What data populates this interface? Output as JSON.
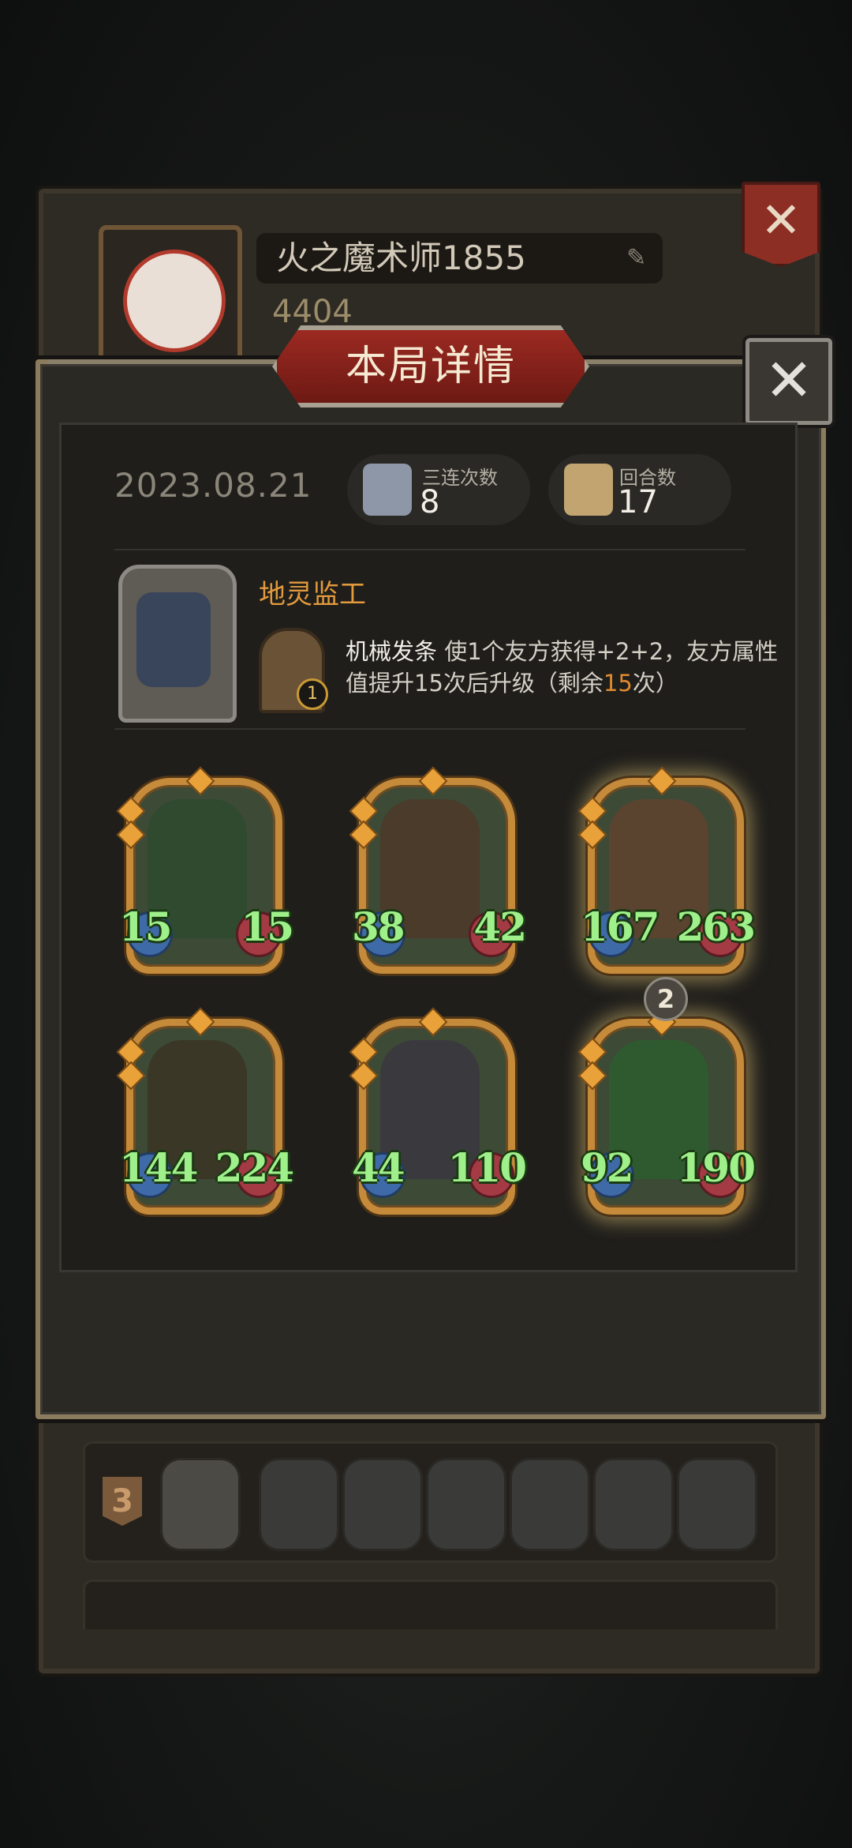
{
  "profile": {
    "name": "火之魔术师1855",
    "score": "4404"
  },
  "back_rows": [
    {
      "rank": "3"
    }
  ],
  "modal": {
    "title": "本局详情",
    "date": "2023.08.21",
    "stats": {
      "triple_label": "三连次数",
      "triple_value": "8",
      "rounds_label": "回合数",
      "rounds_value": "17"
    },
    "hero": {
      "name": "地灵监工",
      "skill_level": "1",
      "skill_name": "机械发条",
      "desc_a": " 使1个友方获得+2+2，友方属性值提升15次后升级（剩余",
      "desc_hl": "15",
      "desc_b": "次）"
    },
    "units": [
      {
        "atk": "15",
        "hp": "15",
        "art_color": "#2f4a2e",
        "golden": false,
        "level": ""
      },
      {
        "atk": "38",
        "hp": "42",
        "art_color": "#4b3b2a",
        "golden": false,
        "level": ""
      },
      {
        "atk": "167",
        "hp": "263",
        "art_color": "#5a4430",
        "golden": true,
        "level": ""
      },
      {
        "atk": "144",
        "hp": "224",
        "art_color": "#3a3726",
        "golden": false,
        "level": ""
      },
      {
        "atk": "44",
        "hp": "110",
        "art_color": "#3a3a3e",
        "golden": false,
        "level": ""
      },
      {
        "atk": "92",
        "hp": "190",
        "art_color": "#2f5a30",
        "golden": true,
        "level": "2"
      }
    ]
  },
  "colors": {
    "accent_orange": "#e08a30",
    "stat_green": "#9ff08a",
    "title_red": "#9b2a22"
  },
  "icons": [
    "pen-icon",
    "close-icon",
    "triple-icon",
    "rounds-icon",
    "skill-icon"
  ]
}
